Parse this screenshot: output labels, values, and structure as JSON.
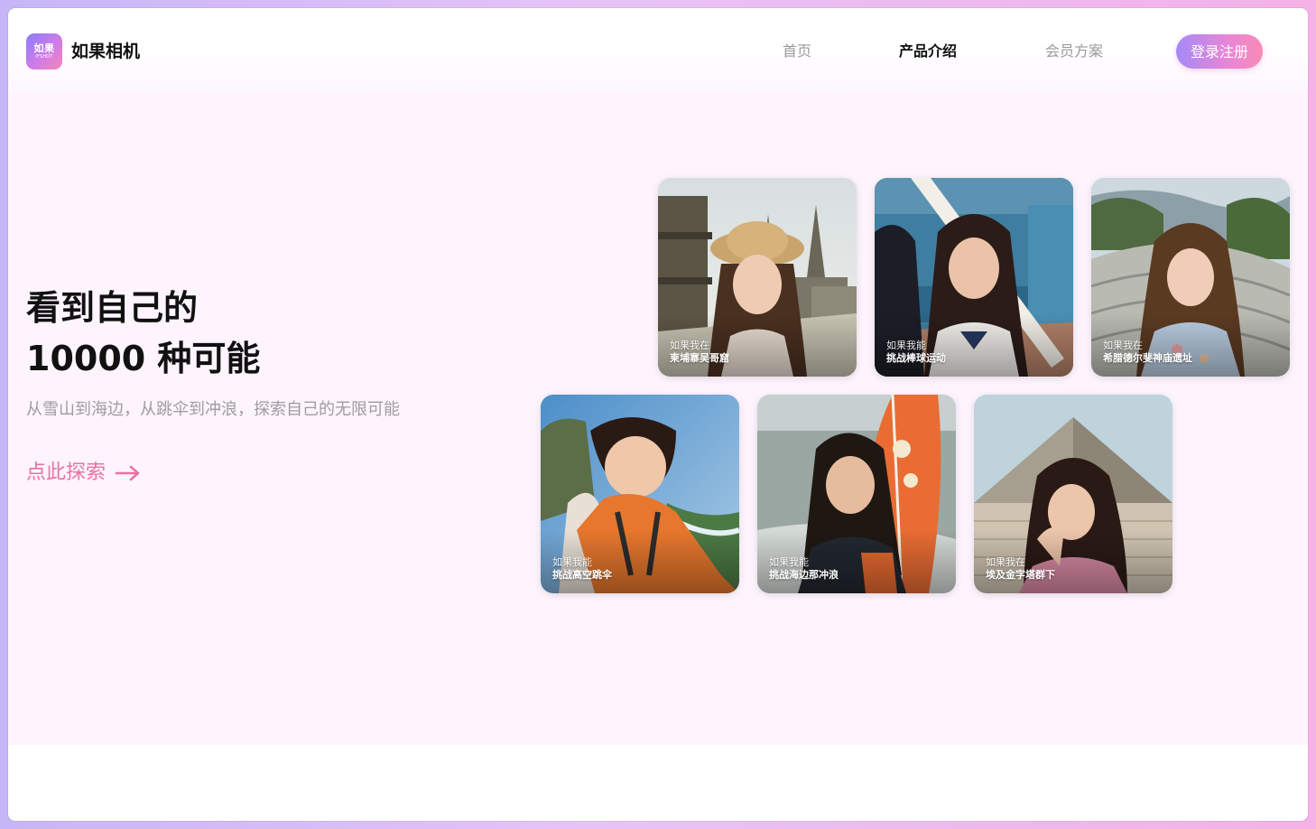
{
  "app": {
    "logo_cn": "如果",
    "logo_en": "IFSHOT",
    "brand_name": "如果相机"
  },
  "nav": {
    "items": [
      "首页",
      "产品介绍",
      "会员方案"
    ],
    "active_index": 1,
    "login_label": "登录注册"
  },
  "hero": {
    "title_line1": "看到自己的",
    "title_line2": "10000 种可能",
    "subtitle": "从雪山到海边，从跳伞到冲浪，探索自己的无限可能",
    "cta_label": "点此探索",
    "cta_icon": "arrow-right-icon"
  },
  "gallery": [
    {
      "prefix": "如果我在",
      "title": "柬埔寨吴哥窟"
    },
    {
      "prefix": "如果我能",
      "title": "挑战棒球运动"
    },
    {
      "prefix": "如果我在",
      "title": "希腊德尔斐神庙遗址"
    },
    {
      "prefix": "如果我能",
      "title": "挑战高空跳伞"
    },
    {
      "prefix": "如果我能",
      "title": "挑战海边那冲浪"
    },
    {
      "prefix": "如果我在",
      "title": "埃及金字塔群下"
    }
  ],
  "colors": {
    "accent_pink": "#e8749f",
    "gradient_start": "#a58af8",
    "gradient_end": "#f68bb6"
  }
}
